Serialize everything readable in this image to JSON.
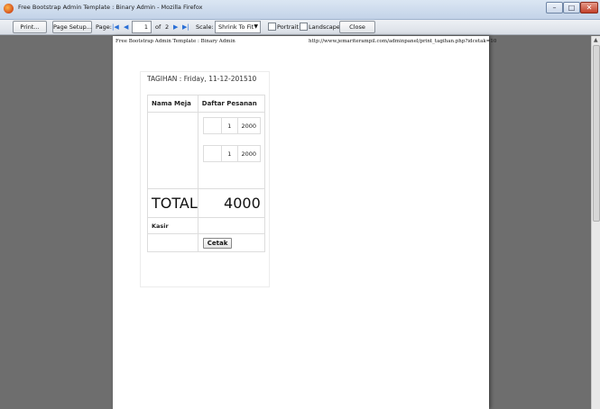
{
  "window": {
    "title": "Free Bootstrap Admin Template : Binary Admin - Mozilla Firefox",
    "controls": {
      "minimize": "–",
      "maximize": "□",
      "close": "✕"
    }
  },
  "toolbar": {
    "print_label": "Print...",
    "page_setup_label": "Page Setup...",
    "page_label": "Page:",
    "current_page": "1",
    "of_label": "of",
    "total_pages": "2",
    "scale_label": "Scale:",
    "scale_value": "Shrink To Fit",
    "portrait_label": "Portrait",
    "landscape_label": "Landscape",
    "close_label": "Close"
  },
  "page": {
    "header_left": "Free Bootstrap Admin Template : Binary Admin",
    "header_right": "http://www.jemariterampil.com/adminpanel/print_tagihan.php?idcetak=10",
    "bill": {
      "title": "TAGIHAN : Friday, 11-12-201510",
      "col_table": "Nama Meja",
      "col_orders": "Daftar Pesanan",
      "orders": [
        {
          "qty": "1",
          "price": "2000"
        },
        {
          "qty": "1",
          "price": "2000"
        }
      ],
      "total_label": "TOTAL",
      "total_value": "4000",
      "kasir_label": "Kasir",
      "cetak_label": "Cetak"
    }
  }
}
